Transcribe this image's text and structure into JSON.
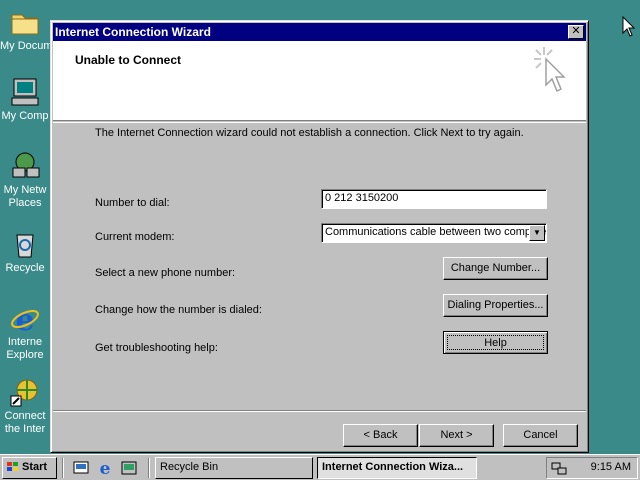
{
  "desktop": {
    "icons": [
      {
        "label": "My Docum",
        "icon": "folder-icon"
      },
      {
        "label": "My Comp",
        "icon": "computer-icon"
      },
      {
        "label": "My Netw",
        "label2": "Places",
        "icon": "network-icon"
      },
      {
        "label": "Recycle",
        "icon": "recycle-bin-icon"
      },
      {
        "label": "Interne",
        "label2": "Explore",
        "icon": "internet-explorer-icon"
      },
      {
        "label": "Connect",
        "label2": "the Inter",
        "icon": "connect-internet-icon"
      }
    ]
  },
  "window": {
    "title": "Internet Connection Wizard",
    "close_label": "✕",
    "header_title": "Unable to Connect",
    "message": "The Internet Connection wizard could not establish a connection. Click Next to try again.",
    "number_label": "Number to dial:",
    "number_value": "0 212 3150200",
    "modem_label": "Current modem:",
    "modem_value": "Communications cable between two computers",
    "change_number_label": "Select a new phone number:",
    "change_number_button": "Change Number...",
    "dialing_label": "Change how the number is dialed:",
    "dialing_button": "Dialing Properties...",
    "help_label": "Get troubleshooting help:",
    "help_button": "Help",
    "back_button": "< Back",
    "next_button": "Next >",
    "cancel_button": "Cancel"
  },
  "taskbar": {
    "start_label": "Start",
    "tasks": [
      "Recycle Bin",
      "Internet Connection Wiza..."
    ],
    "clock": "9:15 AM"
  },
  "colors": {
    "desktop": "#3a8a8a",
    "titlebar": "#000080",
    "face": "#c0c0c0"
  }
}
